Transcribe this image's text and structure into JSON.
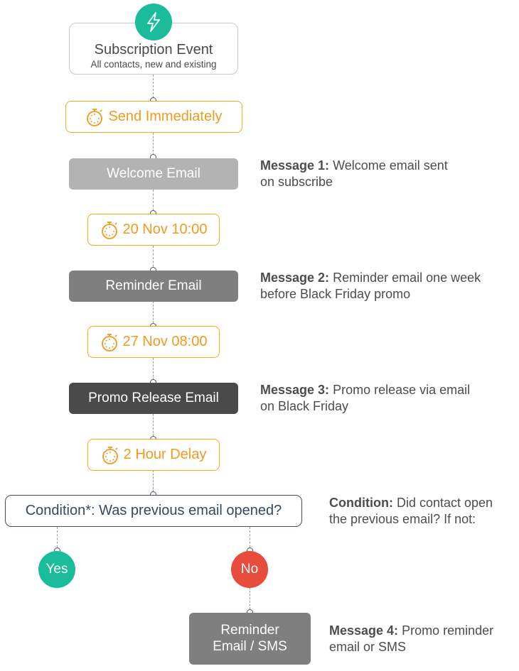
{
  "trigger": {
    "icon": "lightning-bolt-icon",
    "title": "Subscription Event",
    "subtitle": "All contacts, new and existing"
  },
  "steps": [
    {
      "type": "timer",
      "icon": "stopwatch-icon",
      "label": "Send Immediately"
    },
    {
      "type": "email",
      "label": "Welcome Email",
      "color": "#b3b3b3"
    },
    {
      "type": "timer",
      "icon": "stopwatch-icon",
      "label": "20 Nov 10:00"
    },
    {
      "type": "email",
      "label": "Reminder Email",
      "color": "#7f7f7f"
    },
    {
      "type": "timer",
      "icon": "stopwatch-icon",
      "label": "27 Nov 08:00"
    },
    {
      "type": "email",
      "label": "Promo Release Email",
      "color": "#4a4a4a"
    },
    {
      "type": "timer",
      "icon": "stopwatch-icon",
      "label": "2 Hour Delay"
    }
  ],
  "condition": {
    "label": "Condition*: Was previous email opened?",
    "yes": {
      "label": "Yes",
      "color": "#1abc9c"
    },
    "no": {
      "label": "No",
      "color": "#e74c3c"
    },
    "no_action": {
      "label_line1": "Reminder",
      "label_line2": "Email / SMS",
      "color": "#7f7f7f"
    }
  },
  "notes": [
    {
      "title": "Message 1:",
      "text_line1": "Welcome email sent",
      "text_line2": "on subscribe"
    },
    {
      "title": "Message 2:",
      "text_line1": "Reminder email one week",
      "text_line2": "before Black Friday promo"
    },
    {
      "title": "Message 3:",
      "text_line1": "Promo release via email",
      "text_line2": "on Black Friday"
    },
    {
      "title": "Condition:",
      "text_line1": "Did contact open",
      "text_line2": "the previous email? If not:"
    },
    {
      "title": "Message 4:",
      "text_line1": "Promo reminder",
      "text_line2": "email or SMS"
    }
  ],
  "colors": {
    "accent_orange": "#f5a623",
    "teal": "#1abc9c",
    "red": "#e74c3c",
    "condition_border": "#3d4f63"
  }
}
